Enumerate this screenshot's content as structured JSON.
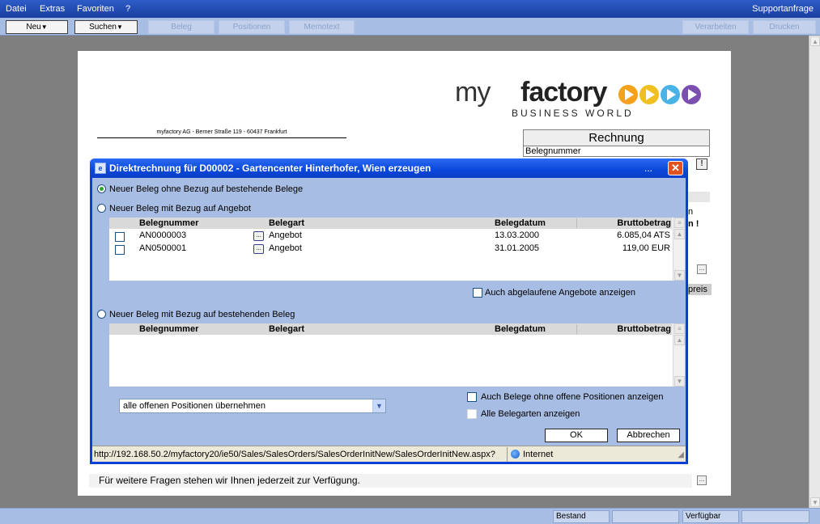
{
  "menu": {
    "items": [
      "Datei",
      "Extras",
      "Favoriten",
      "?"
    ],
    "right": "Supportanfrage"
  },
  "toolbar": {
    "neu": "Neu",
    "suchen": "Suchen",
    "beleg": "Beleg",
    "positionen": "Positionen",
    "memotext": "Memotext",
    "verarbeiten": "Verarbeiten",
    "drucken": "Drucken"
  },
  "page": {
    "logo_my": "my",
    "logo_factory": "factory",
    "logo_sub": "BUSINESS WORLD",
    "sender": "myfactory AG - Berner Straße 119 - 60437 Frankfurt",
    "rechnung_title": "Rechnung",
    "belegnummer": "Belegnummer",
    "frag_n": "n",
    "frag_warn": "n !",
    "frag_preis": "preis",
    "footer": "Für weitere Fragen stehen wir Ihnen jederzeit zur Verfügung."
  },
  "dialog": {
    "title": "Direktrechnung für D00002 - Gartencenter Hinterhofer, Wien erzeugen",
    "title_dots": "...",
    "radio1": "Neuer Beleg ohne Bezug auf bestehende Belege",
    "radio2": "Neuer Beleg mit Bezug auf Angebot",
    "radio3": "Neuer Beleg mit Bezug auf bestehenden Beleg",
    "columns": {
      "belegnummer": "Belegnummer",
      "belegart": "Belegart",
      "belegdatum": "Belegdatum",
      "bruttobetrag": "Bruttobetrag"
    },
    "offers": [
      {
        "nr": "AN0000003",
        "art": "Angebot",
        "datum": "13.03.2000",
        "betrag": "6.085,04 ATS"
      },
      {
        "nr": "AN0500001",
        "art": "Angebot",
        "datum": "31.01.2005",
        "betrag": "119,00 EUR"
      }
    ],
    "check_expired": "Auch abgelaufene Angebote anzeigen",
    "check_no_open": "Auch Belege ohne offene Positionen anzeigen",
    "check_all_types": "Alle Belegarten anzeigen",
    "select_value": "alle offenen Positionen übernehmen",
    "ok": "OK",
    "cancel": "Abbrechen",
    "status_url": "http://192.168.50.2/myfactory20/ie50/Sales/SalesOrders/SalesOrderInitNew/SalesOrderInitNew.aspx?",
    "status_zone": "Internet"
  },
  "statusbar": {
    "bestand": "Bestand",
    "verfuegbar": "Verfügbar"
  },
  "colors": {
    "titlebar": "#0a47d9",
    "dialog_body": "#a8bde3",
    "close": "#e0521f",
    "workspace": "#7f7f7f"
  },
  "icons": [
    "dialog-app-icon",
    "close-icon",
    "dropdown-arrow-icon",
    "ellipsis-icon",
    "globe-icon",
    "alert-icon"
  ]
}
